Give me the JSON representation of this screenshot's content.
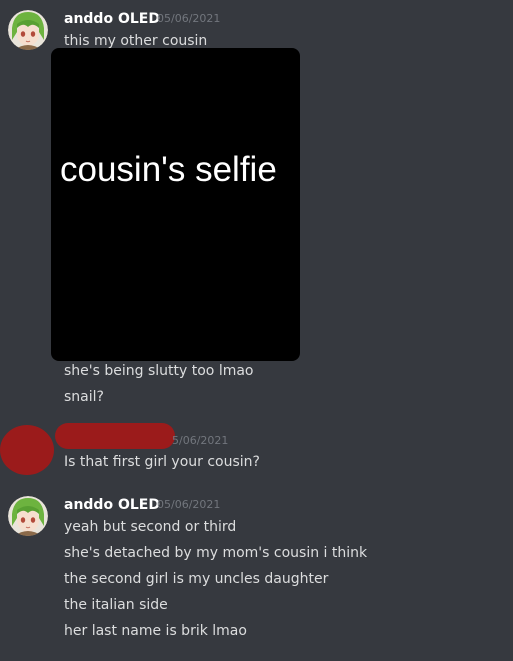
{
  "colors": {
    "background": "#36393f",
    "username": "#ffffff",
    "message_text": "#dcddde",
    "timestamp": "#72767d",
    "redaction": "#9b1b1b",
    "attachment_bg": "#000000"
  },
  "messages": [
    {
      "author": "anddo OLED",
      "timestamp": "05/06/2021",
      "lines": [
        "this my other cousin"
      ],
      "attachment_label": "cousin's selfie",
      "after_lines": [
        "she's being slutty too lmao",
        "snail?"
      ]
    },
    {
      "author": "",
      "timestamp": "5/06/2021",
      "lines": [
        "Is that first girl your cousin?"
      ]
    },
    {
      "author": "anddo OLED",
      "timestamp": "05/06/2021",
      "lines": [
        "yeah but second or third",
        "she's detached by my mom's cousin i think",
        "the second girl is my uncles daughter",
        "the italian side",
        "her last name is brik lmao"
      ]
    }
  ],
  "icons": {
    "avatar": "avatar-anime-green-hair-icon"
  }
}
